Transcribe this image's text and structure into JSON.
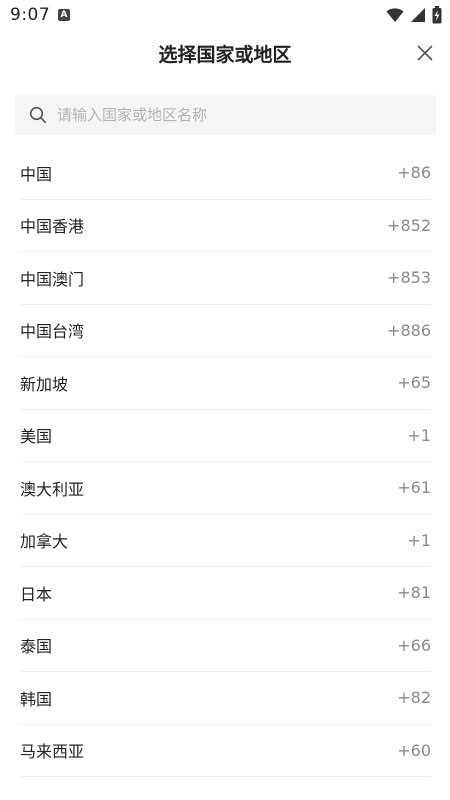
{
  "status_bar": {
    "time": "9:07",
    "notification_icon": "a-icon",
    "icons": [
      "wifi-icon",
      "signal-icon",
      "battery-charging-icon"
    ]
  },
  "header": {
    "title": "选择国家或地区",
    "close_icon": "close-icon"
  },
  "search": {
    "placeholder": "请输入国家或地区名称",
    "value": "",
    "icon": "search-icon"
  },
  "countries": [
    {
      "name": "中国",
      "code": "+86"
    },
    {
      "name": "中国香港",
      "code": "+852"
    },
    {
      "name": "中国澳门",
      "code": "+853"
    },
    {
      "name": "中国台湾",
      "code": "+886"
    },
    {
      "name": "新加坡",
      "code": "+65"
    },
    {
      "name": "美国",
      "code": "+1"
    },
    {
      "name": "澳大利亚",
      "code": "+61"
    },
    {
      "name": "加拿大",
      "code": "+1"
    },
    {
      "name": "日本",
      "code": "+81"
    },
    {
      "name": "泰国",
      "code": "+66"
    },
    {
      "name": "韩国",
      "code": "+82"
    },
    {
      "name": "马来西亚",
      "code": "+60"
    }
  ],
  "colors": {
    "title": "#222222",
    "code": "#8a8a8a",
    "search_bg": "#f5f5f6",
    "divider": "#f0f0f0"
  }
}
